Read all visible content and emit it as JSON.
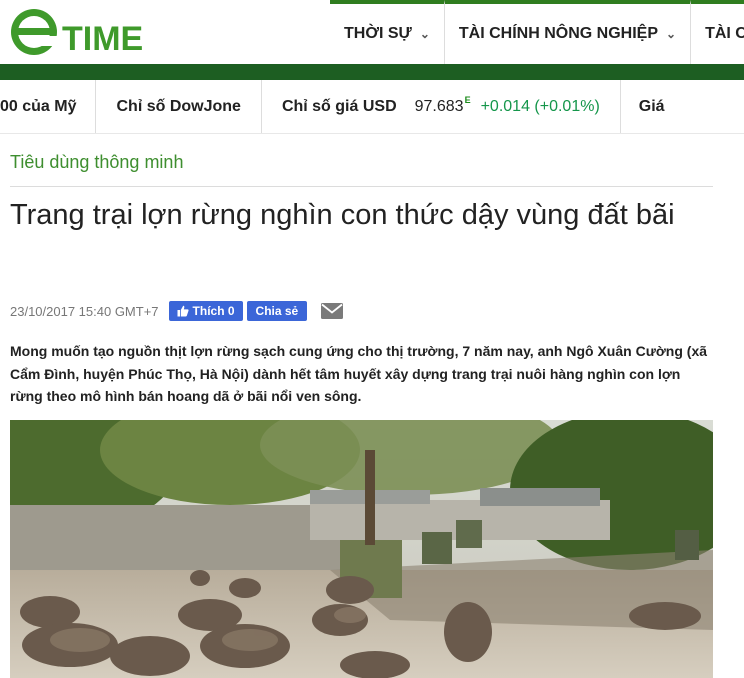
{
  "header": {
    "logo_text": "TIME",
    "nav": [
      {
        "label": "THỜI SỰ"
      },
      {
        "label": "TÀI CHÍNH NÔNG NGHIỆP"
      },
      {
        "label": "TÀI C"
      }
    ]
  },
  "ticker": {
    "item1": "00 của Mỹ",
    "item2": "Chỉ số DowJone",
    "item3_label": "Chỉ số giá USD",
    "item3_value": "97.683",
    "item3_marker": "E",
    "item3_change": "+0.014 (+0.01%)",
    "item4": "Giá"
  },
  "article": {
    "category": "Tiêu dùng thông minh",
    "title": "Trang trại lợn rừng nghìn con thức dậy vùng đất bãi",
    "date": "23/10/2017 15:40 GMT+7",
    "like_label": "Thích 0",
    "share_label": "Chia sẻ",
    "sapo": "Mong muốn tạo nguồn thịt lợn rừng sạch cung ứng cho thị trường, 7 năm nay, anh Ngô Xuân Cường (xã Cẩm Đình, huyện Phúc Thọ, Hà Nội) dành hết tâm huyết xây dựng trang trại nuôi hàng nghìn con lợn rừng theo mô hình bán hoang dã ở bãi nổi ven sông."
  },
  "colors": {
    "brand_green": "#1d5e22",
    "category_green": "#3e8e2f",
    "facebook_blue": "#3b66d8",
    "change_green": "#15964b"
  },
  "icons": [
    "etime-logo",
    "chevron-down-icon",
    "thumbs-up-icon",
    "mail-icon"
  ]
}
